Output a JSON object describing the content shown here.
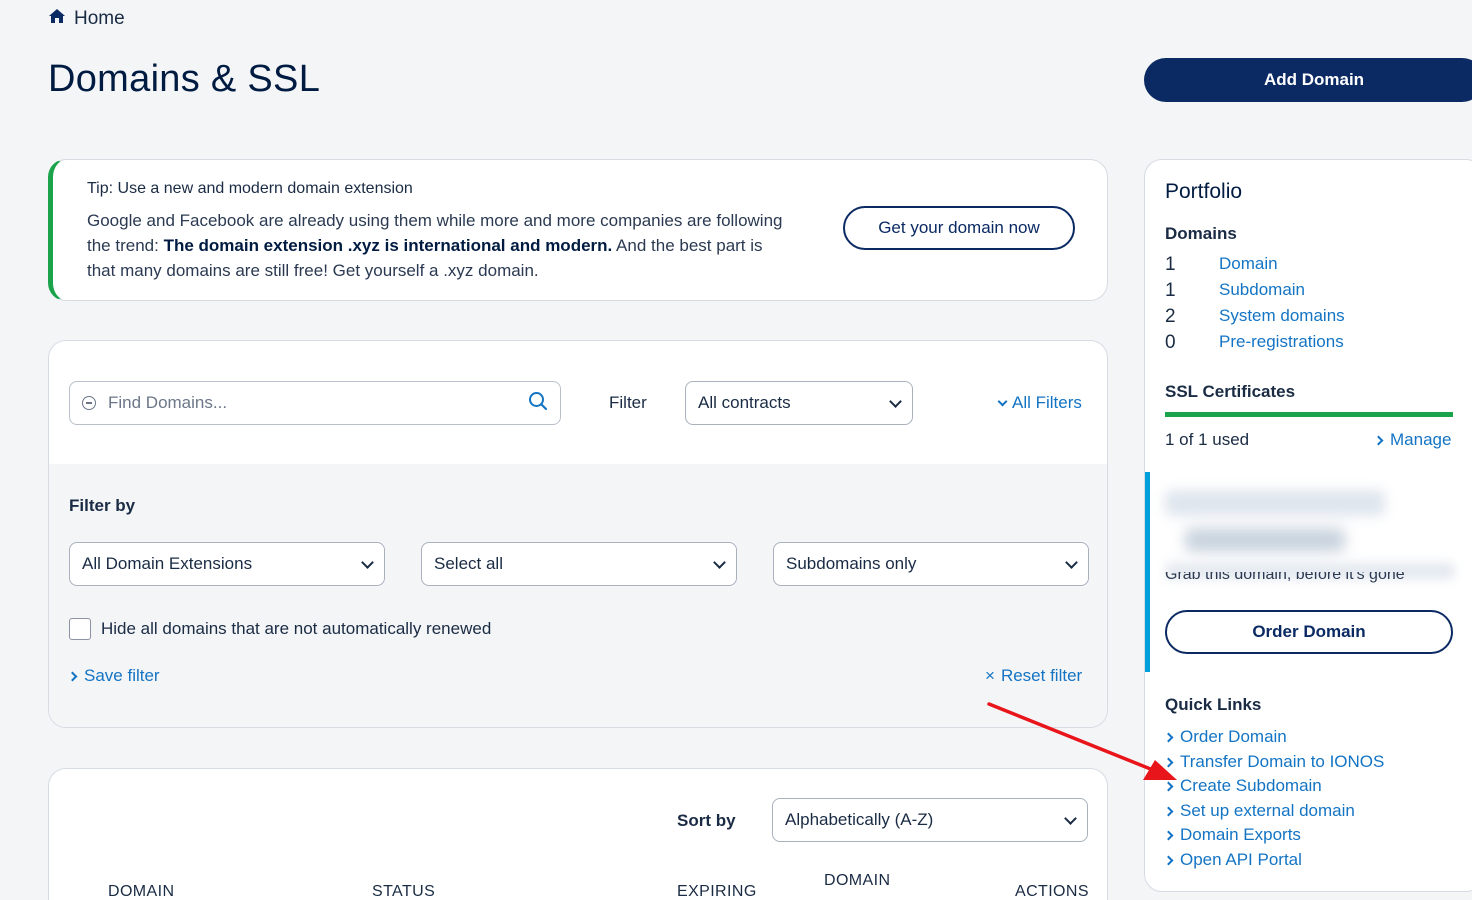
{
  "breadcrumb": {
    "home": "Home"
  },
  "page": {
    "title": "Domains & SSL",
    "add_domain": "Add Domain"
  },
  "tip": {
    "heading": "Tip: Use a new and modern domain extension",
    "body_1": "Google and Facebook are already using them while more and more companies are following the trend: ",
    "body_bold": "The domain extension .xyz is international and modern.",
    "body_2": " And the best part is that many domains are still free! Get yourself a .xyz domain.",
    "button": "Get your domain now"
  },
  "filter": {
    "search_placeholder": "Find Domains...",
    "label": "Filter",
    "contracts_value": "All contracts",
    "all_filters": "All Filters",
    "filter_by": "Filter by",
    "extensions_value": "All Domain Extensions",
    "select_all_value": "Select all",
    "subdomains_value": "Subdomains only",
    "hide_checkbox_label": "Hide all domains that are not automatically renewed",
    "save_filter": "Save filter",
    "reset_filter": "Reset filter"
  },
  "list": {
    "sort_by": "Sort by",
    "sort_value": "Alphabetically (A-Z)",
    "columns": [
      "DOMAIN",
      "STATUS",
      "EXPIRING",
      "DOMAIN",
      "ACTIONS"
    ]
  },
  "portfolio": {
    "title": "Portfolio",
    "domains_heading": "Domains",
    "stats": [
      {
        "count": "1",
        "label": "Domain"
      },
      {
        "count": "1",
        "label": "Subdomain"
      },
      {
        "count": "2",
        "label": "System domains"
      },
      {
        "count": "0",
        "label": "Pre-registrations"
      }
    ],
    "ssl_heading": "SSL Certificates",
    "ssl_used": "1 of 1 used",
    "manage": "Manage",
    "promo_text": "Grab this domain, before it's gone",
    "order_domain": "Order Domain",
    "quick_links_heading": "Quick Links",
    "quick_links": [
      "Order Domain",
      "Transfer Domain to IONOS",
      "Create Subdomain",
      "Set up external domain",
      "Domain Exports",
      "Open API Portal"
    ]
  },
  "colors": {
    "navy": "#0b2a63",
    "link": "#1474c4",
    "green": "#1aa34a",
    "accent_cyan": "#00a0dc",
    "arrow": "#e8151b"
  }
}
